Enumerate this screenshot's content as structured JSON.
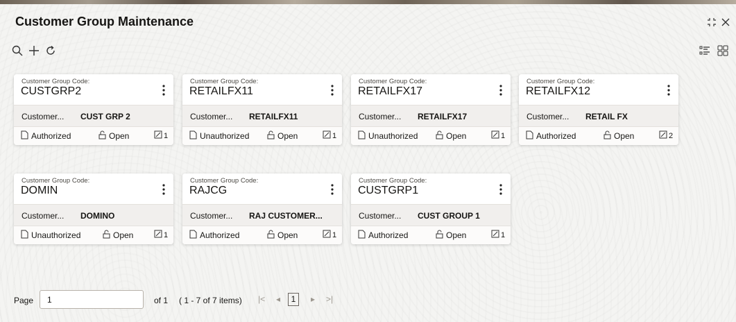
{
  "header": {
    "title": "Customer Group Maintenance"
  },
  "icons": {
    "search": "search-icon",
    "add": "plus-icon",
    "refresh": "refresh-icon",
    "list_view": "list-view-icon",
    "tile_view": "tile-view-icon",
    "maximize": "maximize-icon",
    "close": "close-icon"
  },
  "card_labels": {
    "code_label": "Customer Group Code:",
    "desc_label": "Customer...",
    "open_label": "Open"
  },
  "cards": [
    {
      "code": "CUSTGRP2",
      "desc": "CUST GRP 2",
      "status": "Authorized",
      "mod": "1"
    },
    {
      "code": "RETAILFX11",
      "desc": "RETAILFX11",
      "status": "Unauthorized",
      "mod": "1"
    },
    {
      "code": "RETAILFX17",
      "desc": "RETAILFX17",
      "status": "Unauthorized",
      "mod": "1"
    },
    {
      "code": "RETAILFX12",
      "desc": "RETAIL FX",
      "status": "Authorized",
      "mod": "2"
    },
    {
      "code": "DOMIN",
      "desc": "DOMINO",
      "status": "Unauthorized",
      "mod": "1"
    },
    {
      "code": "RAJCG",
      "desc": "RAJ CUSTOMER...",
      "status": "Authorized",
      "mod": "1"
    },
    {
      "code": "CUSTGRP1",
      "desc": "CUST GROUP 1",
      "status": "Authorized",
      "mod": "1"
    }
  ],
  "pager": {
    "page_label": "Page",
    "page_value": "1",
    "of_text": "of 1",
    "items_text": "( 1 - 7 of 7 items)",
    "current_page": "1",
    "first": "|<",
    "prev": "◂",
    "next": "▸",
    "last": ">|"
  }
}
